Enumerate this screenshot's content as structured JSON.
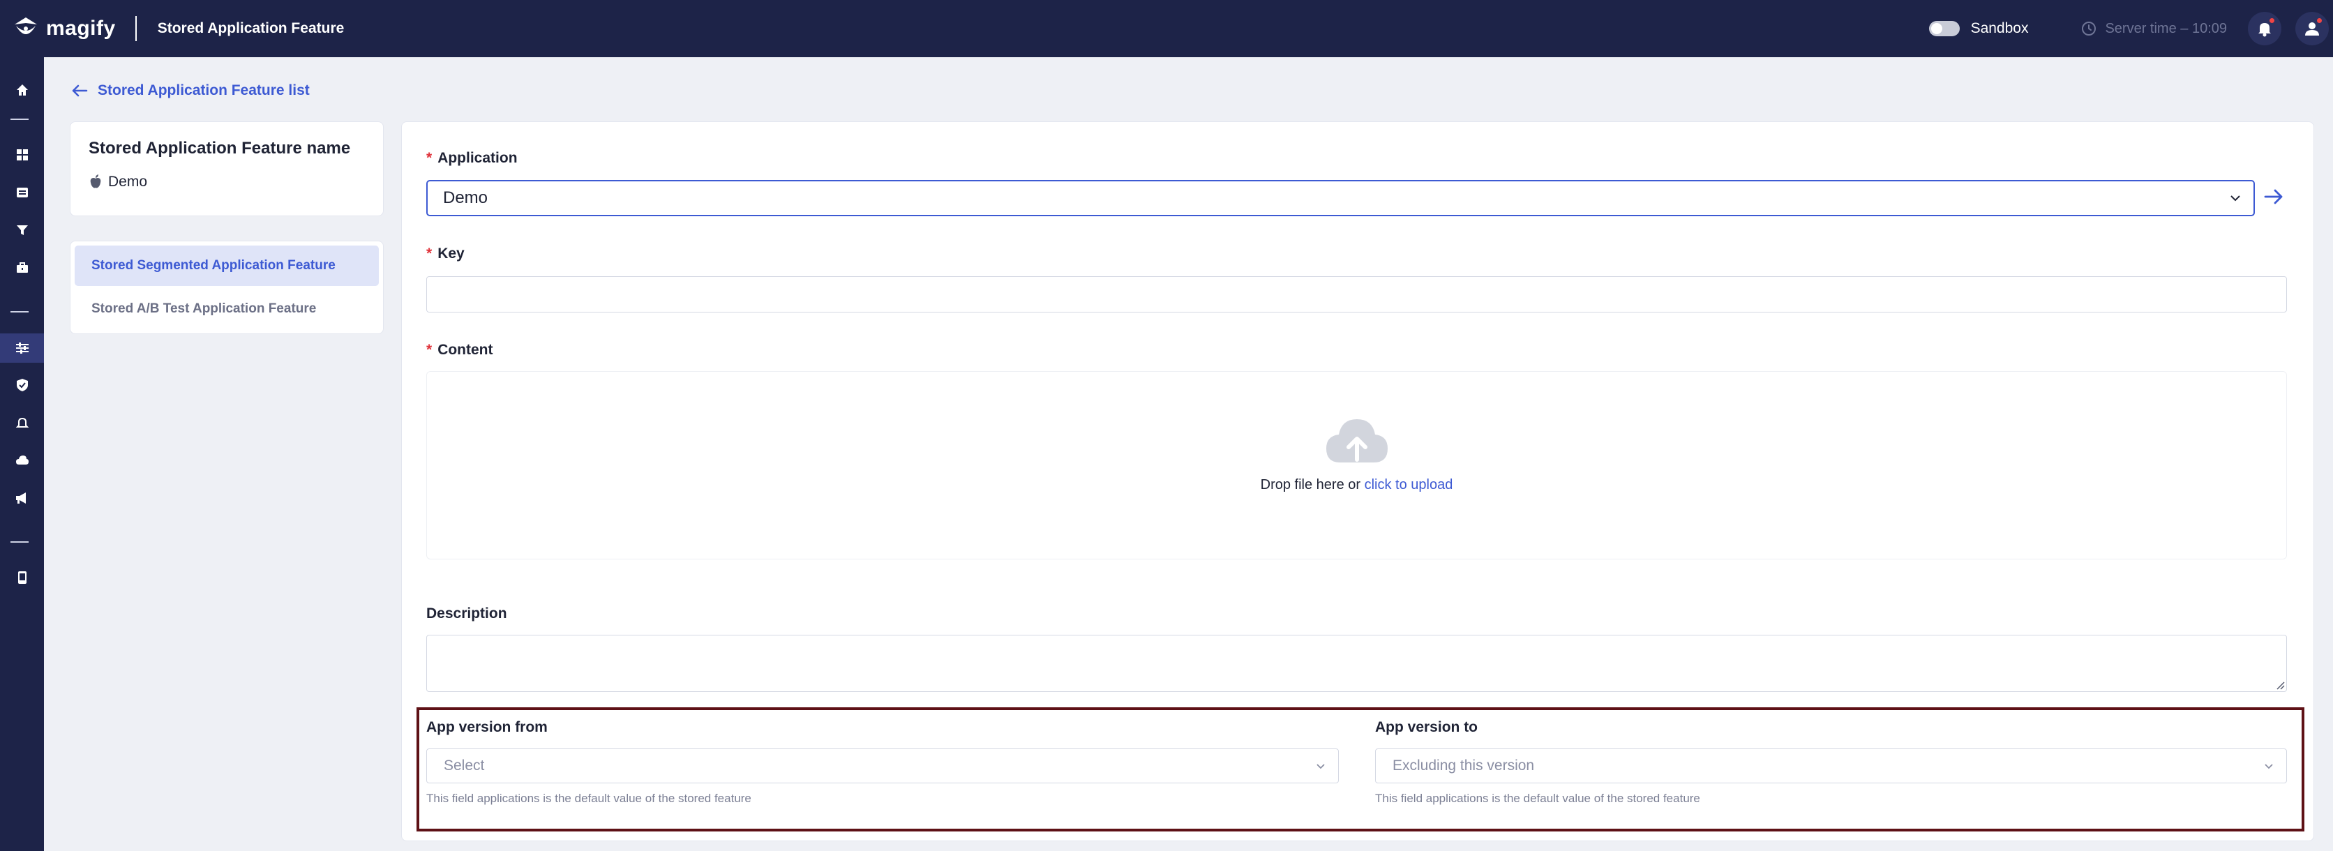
{
  "header": {
    "brand": "magify",
    "page_title": "Stored Application Feature",
    "sandbox_label": "Sandbox",
    "server_time": "Server time – 10:09"
  },
  "rail": {
    "items": [
      "home-icon",
      "grid-icon",
      "inbox-icon",
      "filter-icon",
      "briefcase-icon",
      "sliders-icon",
      "shield-icon",
      "bell-icon",
      "cloud-icon",
      "megaphone-icon",
      "phone-icon"
    ],
    "active": "sliders-icon"
  },
  "breadcrumb": {
    "back_label": "Stored Application Feature list"
  },
  "summary": {
    "title": "Stored Application Feature name",
    "app_name": "Demo"
  },
  "nav": {
    "items": [
      {
        "label": "Stored Segmented Application Feature",
        "active": true
      },
      {
        "label": "Stored A/B Test Application Feature",
        "active": false
      }
    ]
  },
  "form": {
    "application": {
      "label": "Application",
      "value": "Demo"
    },
    "key": {
      "label": "Key",
      "value": ""
    },
    "content": {
      "label": "Content",
      "drop_text": "Drop file here or",
      "upload_link": "click to upload"
    },
    "description": {
      "label": "Description",
      "value": ""
    },
    "version_from": {
      "label": "App version from",
      "placeholder": "Select",
      "hint": "This field applications is the default value of the stored feature"
    },
    "version_to": {
      "label": "App version to",
      "placeholder": "Excluding this version",
      "hint": "This field applications is the default value of the stored feature"
    }
  },
  "colors": {
    "header_bg": "#1d2348",
    "accent": "#3d5ad3",
    "required": "#e0323a",
    "highlight_border": "#5e1116"
  }
}
